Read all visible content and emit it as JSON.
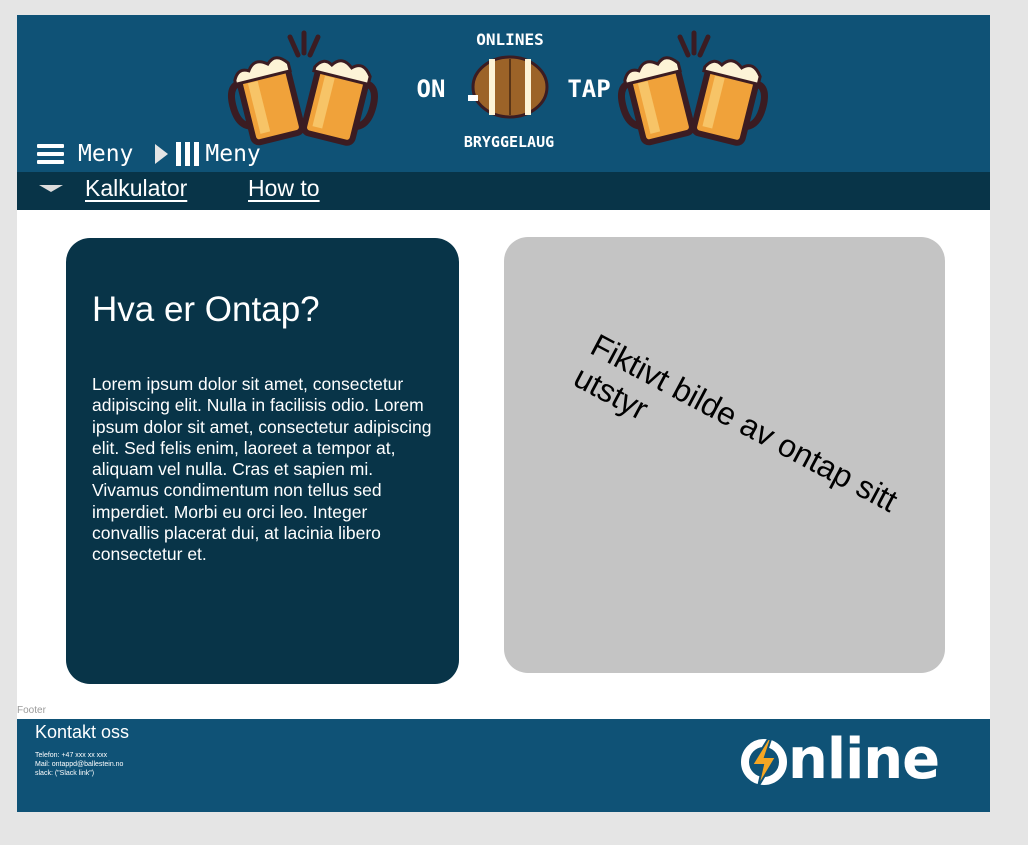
{
  "header": {
    "logo": {
      "top_arc": "ONLINES",
      "left_word": "ON",
      "right_word": "TAP",
      "bottom_arc": "BRYGGELAUG"
    },
    "menu_label_1": "Meny",
    "menu_label_2": "Meny"
  },
  "nav": {
    "links": [
      "Kalkulator",
      "How to"
    ]
  },
  "main": {
    "title": "Hva er Ontap?",
    "body": "Lorem ipsum dolor sit amet, consectetur adipiscing elit. Nulla in facilisis odio. Lorem ipsum dolor sit amet, consectetur adipiscing elit. Sed felis enim, laoreet a tempor at, aliquam vel nulla. Cras et sapien mi. Vivamus condimentum non tellus sed imperdiet. Morbi eu orci leo. Integer convallis placerat dui, at lacinia libero consectetur et.",
    "image_placeholder": "Fiktivt bilde av ontap sitt utstyr"
  },
  "footer": {
    "caption": "Footer",
    "heading": "Kontakt oss",
    "phone": "Telefon: +47 xxx xx xxx",
    "mail": "Mail: ontappd@ballestein.no",
    "slack": "slack: (\"Slack link\")",
    "brand": "nline"
  },
  "colors": {
    "header_bg": "#0f5276",
    "nav_bg": "#083448",
    "card_dark": "#083448",
    "image_placeholder_bg": "#c4c4c4",
    "accent": "#f5a623"
  }
}
